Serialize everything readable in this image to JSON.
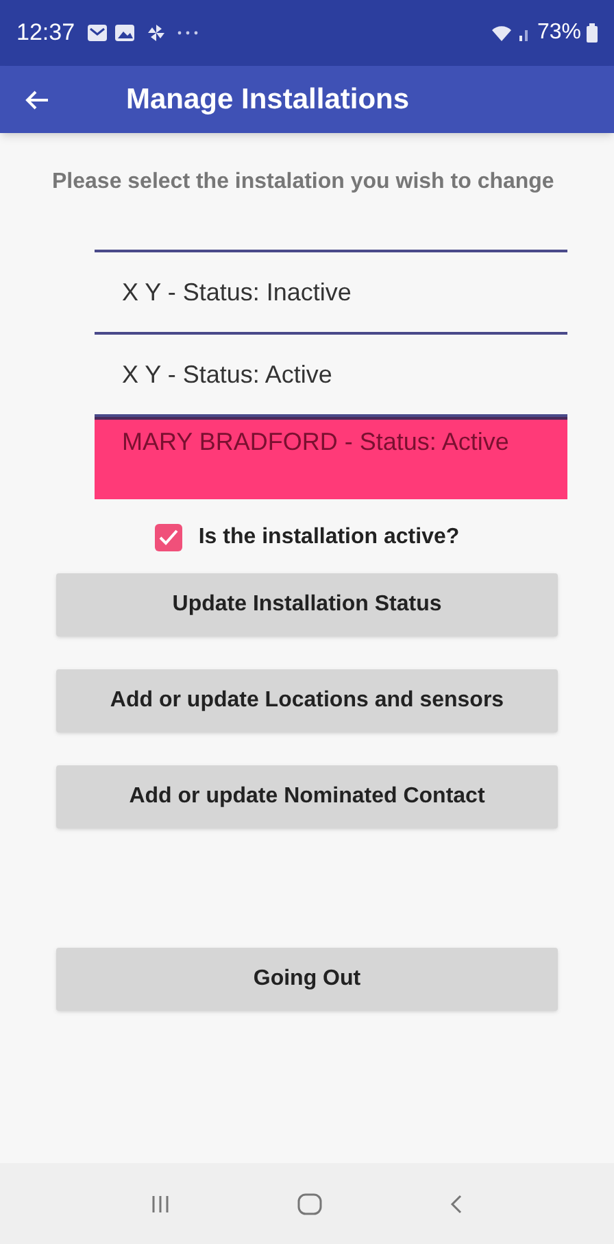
{
  "status_bar": {
    "time": "12:37",
    "battery": "73%"
  },
  "app_bar": {
    "title": "Manage Installations"
  },
  "prompt": "Please select the instalation you wish to change",
  "installations": [
    {
      "label": "X Y  - Status:  Inactive",
      "selected": false
    },
    {
      "label": "X Y  - Status:  Active",
      "selected": false
    },
    {
      "label": "MARY BRADFORD  - Status: Active",
      "selected": true
    }
  ],
  "active_checkbox": {
    "label": "Is the installation active?",
    "checked": true
  },
  "buttons": [
    {
      "label": "Update Installation Status",
      "kind": "action"
    },
    {
      "label": "Add or update Locations and sensors",
      "kind": "action"
    },
    {
      "label": "Add or update Nominated Contact",
      "kind": "action"
    },
    {
      "label": "Going Out",
      "kind": "spaced"
    }
  ]
}
